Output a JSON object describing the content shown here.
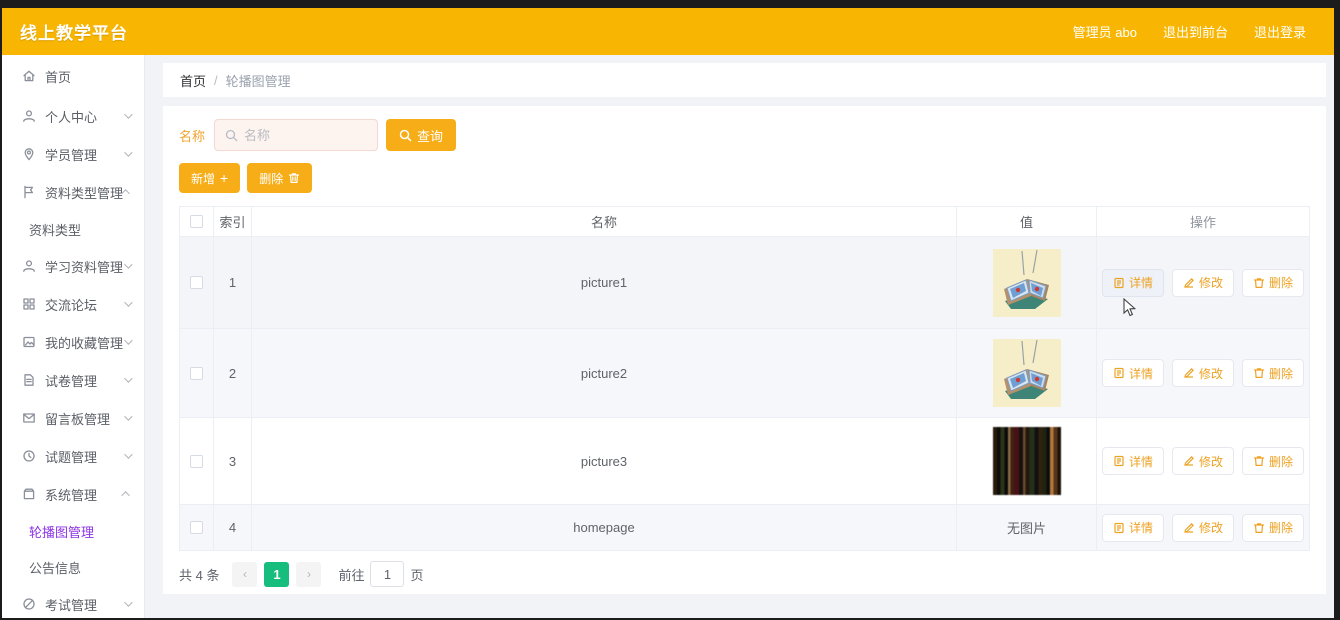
{
  "colors": {
    "header_bg": "#f8b602",
    "button_accent": "#f6ad17",
    "action_text": "#eda223",
    "active_menu_purple": "#8b33e6",
    "pager_active_green": "#16bd7c",
    "row_stripe": "#f6f7fb",
    "search_input_bg": "#fdf3ef"
  },
  "header": {
    "title": "线上教学平台",
    "user": "管理员 abo",
    "link_front": "退出到前台",
    "link_logout": "退出登录"
  },
  "sidebar": {
    "items": [
      {
        "label": "首页",
        "icon": "home-icon"
      },
      {
        "label": "个人中心",
        "icon": "user-icon"
      },
      {
        "label": "学员管理",
        "icon": "map-pin-icon"
      },
      {
        "label": "资料类型管理",
        "icon": "flag-icon",
        "expanded": true,
        "children": [
          {
            "label": "资料类型"
          }
        ]
      },
      {
        "label": "学习资料管理",
        "icon": "user-icon"
      },
      {
        "label": "交流论坛",
        "icon": "grid-icon"
      },
      {
        "label": "我的收藏管理",
        "icon": "picture-icon"
      },
      {
        "label": "试卷管理",
        "icon": "document-icon"
      },
      {
        "label": "留言板管理",
        "icon": "mail-icon"
      },
      {
        "label": "试题管理",
        "icon": "circle-icon"
      },
      {
        "label": "系统管理",
        "icon": "box-icon",
        "expanded": true,
        "children": [
          {
            "label": "轮播图管理",
            "active": true
          },
          {
            "label": "公告信息"
          }
        ]
      },
      {
        "label": "考试管理",
        "icon": "slash-circle-icon"
      }
    ]
  },
  "breadcrumb": {
    "home": "首页",
    "separator": "/",
    "current": "轮播图管理"
  },
  "search": {
    "label": "名称",
    "placeholder": "名称",
    "query_button": "查询"
  },
  "toolbar": {
    "add_button": "新增",
    "add_symbol": "+",
    "delete_button": "删除"
  },
  "table": {
    "columns": {
      "index": "索引",
      "name": "名称",
      "value": "值",
      "action": "操作"
    },
    "action_buttons": {
      "detail": "详情",
      "edit": "修改",
      "delete": "删除"
    },
    "rows": [
      {
        "index": "1",
        "name": "picture1",
        "value_type": "image",
        "image": "open-book-thumbnail"
      },
      {
        "index": "2",
        "name": "picture2",
        "value_type": "image",
        "image": "open-book-thumbnail"
      },
      {
        "index": "3",
        "name": "picture3",
        "value_type": "image",
        "image": "book-spines-thumbnail"
      },
      {
        "index": "4",
        "name": "homepage",
        "value_type": "text",
        "value_text": "无图片"
      }
    ]
  },
  "pagination": {
    "total": "共 4 条",
    "prev": "‹",
    "page": "1",
    "next": "›",
    "goto_label": "前往",
    "goto_value": "1",
    "unit": "页"
  }
}
